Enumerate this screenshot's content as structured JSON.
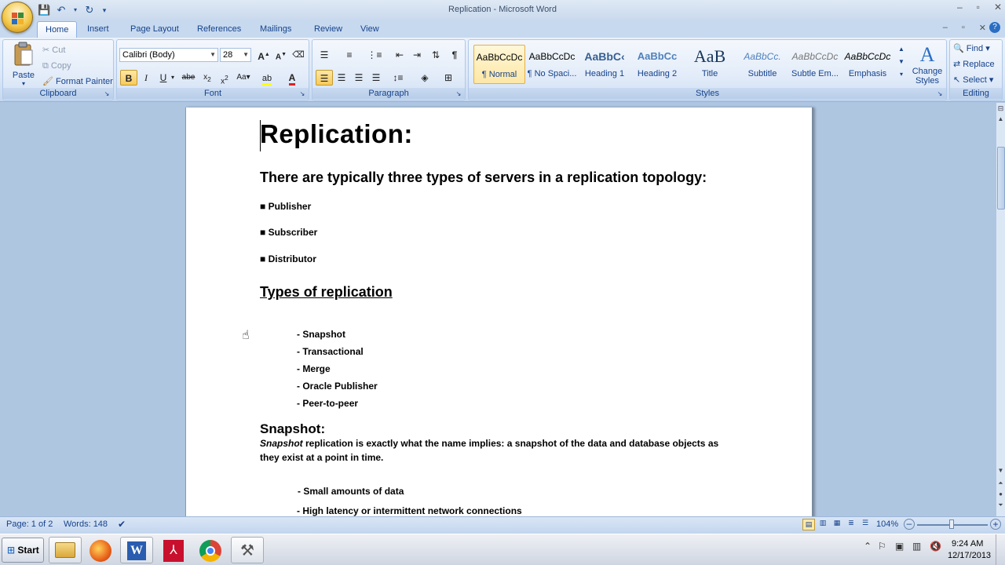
{
  "window": {
    "title": "Replication - Microsoft Word"
  },
  "tabs": [
    "Home",
    "Insert",
    "Page Layout",
    "References",
    "Mailings",
    "Review",
    "View"
  ],
  "clipboard": {
    "paste": "Paste",
    "cut": "Cut",
    "copy": "Copy",
    "format_painter": "Format Painter",
    "label": "Clipboard"
  },
  "font": {
    "name": "Calibri (Body)",
    "size": "28",
    "label": "Font"
  },
  "paragraph": {
    "label": "Paragraph"
  },
  "styles": {
    "label": "Styles",
    "tiles": [
      {
        "preview": "AaBbCcDc",
        "name": "¶ Normal"
      },
      {
        "preview": "AaBbCcDc",
        "name": "¶ No Spaci..."
      },
      {
        "preview": "AaBbC‹",
        "name": "Heading 1"
      },
      {
        "preview": "AaBbCc",
        "name": "Heading 2"
      },
      {
        "preview": "AaB",
        "name": "Title"
      },
      {
        "preview": "AaBbCc.",
        "name": "Subtitle"
      },
      {
        "preview": "AaBbCcDc",
        "name": "Subtle Em..."
      },
      {
        "preview": "AaBbCcDc",
        "name": "Emphasis"
      }
    ],
    "change_styles": "Change Styles"
  },
  "editing": {
    "find": "Find",
    "replace": "Replace",
    "select": "Select",
    "label": "Editing"
  },
  "document": {
    "title": "Replication:",
    "intro": "There are typically  three types of servers in a replication topology:",
    "server_types": [
      "Publisher",
      "Subscriber",
      "Distributor"
    ],
    "types_heading": "Types of replication",
    "types": [
      "Snapshot",
      "Transactional",
      "Merge",
      "Oracle Publisher",
      "Peer-to-peer"
    ],
    "snapshot_heading": "Snapshot:",
    "snapshot_italic": "Snapshot",
    "snapshot_line1": " replication  is exactly  what the name implies: a snapshot of the data and database  objects as",
    "snapshot_line2": "they exist at a point  in time.",
    "snapshot_points": [
      "Small amounts of data",
      "High latency or intermittent network connections"
    ]
  },
  "status": {
    "page": "Page: 1 of 2",
    "words": "Words: 148",
    "zoom": "104%"
  },
  "taskbar": {
    "start": "Start",
    "time": "9:24 AM",
    "date": "12/17/2013"
  }
}
